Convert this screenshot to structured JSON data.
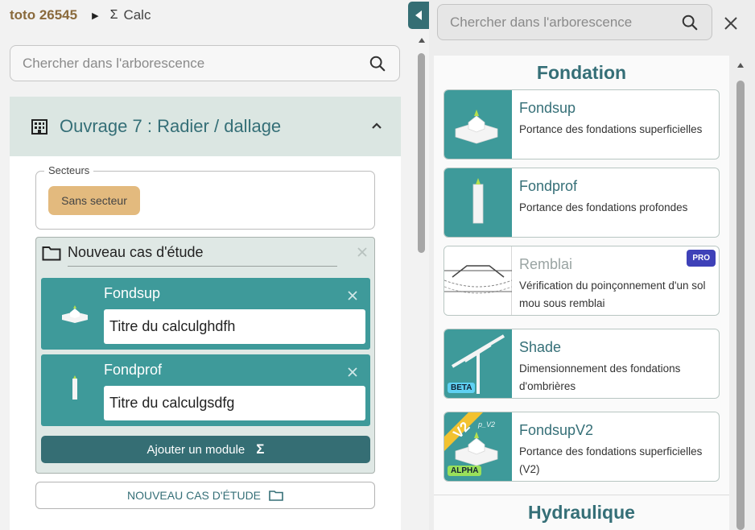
{
  "breadcrumb": {
    "project": "toto 26545",
    "module": "Calc"
  },
  "left_search": {
    "placeholder": "Chercher dans l'arborescence"
  },
  "ouvrage": {
    "title": "Ouvrage 7 : Radier / dallage",
    "secteurs_legend": "Secteurs",
    "secteur_badge": "Sans secteur",
    "cas": {
      "title": "Nouveau cas d'étude",
      "modules": [
        {
          "name": "Fondsup",
          "value": "Titre du calculghdfh"
        },
        {
          "name": "Fondprof",
          "value": "Titre du calculgsdfg"
        }
      ],
      "add_module_label": "Ajouter un module"
    },
    "new_cas_label": "NOUVEAU CAS D'ÉTUDE"
  },
  "right_search": {
    "placeholder": "Chercher dans l'arborescence"
  },
  "catalog": {
    "categories": [
      {
        "title": "Fondation"
      },
      {
        "title": "Hydraulique"
      }
    ],
    "cards": [
      {
        "name": "Fondsup",
        "desc": "Portance des fondations superficielles"
      },
      {
        "name": "Fondprof",
        "desc": "Portance des fondations profondes"
      },
      {
        "name": "Remblai",
        "desc": "Vérification du poinçonnement d'un sol mou sous remblai",
        "badge": "PRO"
      },
      {
        "name": "Shade",
        "desc": "Dimensionnement des fondations d'ombrières",
        "badge": "BETA"
      },
      {
        "name": "FondsupV2",
        "desc": "Portance des fondations superficielles (V2)",
        "badge": "ALPHA",
        "ribbon": "V2",
        "sub_label": "p_V2"
      }
    ]
  },
  "colors": {
    "teal": "#3e9a9a",
    "teal_dark": "#356e74",
    "project": "#8a6a3c",
    "secteur": "#e3ba7e",
    "pro": "#3e41b8",
    "beta": "#5fd1f2",
    "alpha": "#9ae05a"
  }
}
